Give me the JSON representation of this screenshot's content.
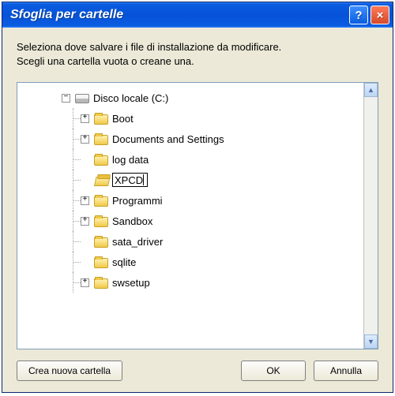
{
  "titlebar": {
    "title": "Sfoglia per cartelle",
    "help_symbol": "?",
    "close_symbol": "×"
  },
  "instructions": {
    "line1": "Seleziona dove salvare i file di installazione da modificare.",
    "line2": "Scegli una cartella vuota o creane una."
  },
  "tree": {
    "root": {
      "label": "Disco locale (C:)",
      "toggle": "−"
    },
    "items": [
      {
        "label": "Boot",
        "toggle": "+",
        "open": false
      },
      {
        "label": "Documents and Settings",
        "toggle": "+",
        "open": false
      },
      {
        "label": "log data",
        "toggle": "",
        "open": false
      },
      {
        "label": "XPCD",
        "toggle": "",
        "open": true,
        "rename": true
      },
      {
        "label": "Programmi",
        "toggle": "+",
        "open": false
      },
      {
        "label": "Sandbox",
        "toggle": "+",
        "open": false
      },
      {
        "label": "sata_driver",
        "toggle": "",
        "open": false
      },
      {
        "label": "sqlite",
        "toggle": "",
        "open": false
      },
      {
        "label": "swsetup",
        "toggle": "+",
        "open": false
      }
    ]
  },
  "buttons": {
    "new_folder": "Crea nuova cartella",
    "ok": "OK",
    "cancel": "Annulla"
  },
  "scrollbar": {
    "up": "▲",
    "down": "▼"
  }
}
